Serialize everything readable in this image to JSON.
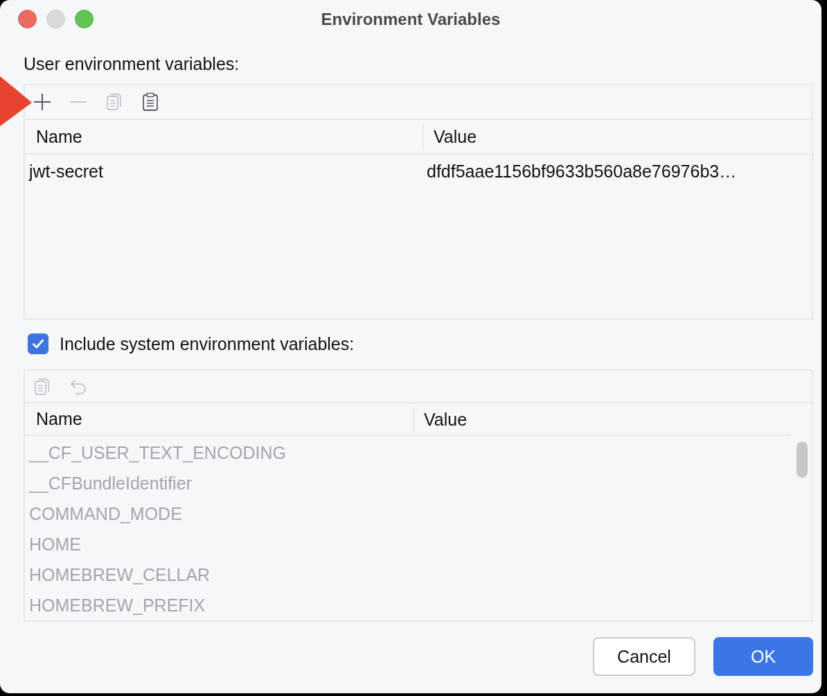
{
  "window": {
    "title": "Environment Variables"
  },
  "user_section": {
    "label": "User environment variables:",
    "read_only": false,
    "toolbar": [
      {
        "kind": "add",
        "disabled": false
      },
      {
        "kind": "remove",
        "disabled": true
      },
      {
        "kind": "copy",
        "disabled": true
      },
      {
        "kind": "paste",
        "disabled": false
      }
    ],
    "columns": [
      "Name",
      "Value"
    ],
    "rows": [
      {
        "name": "jwt-secret",
        "value": "dfdf5aae1156bf9633b560a8e76976b3…"
      }
    ]
  },
  "system_section": {
    "include_label": "Include system environment variables:",
    "checked": true,
    "read_only": true,
    "toolbar": [
      {
        "kind": "copy",
        "disabled": true
      },
      {
        "kind": "undo",
        "disabled": true
      }
    ],
    "columns": [
      "Name",
      "Value"
    ],
    "rows": [
      {
        "name": "__CF_USER_TEXT_ENCODING"
      },
      {
        "name": "__CFBundleIdentifier"
      },
      {
        "name": "COMMAND_MODE"
      },
      {
        "name": "HOME"
      },
      {
        "name": "HOMEBREW_CELLAR"
      },
      {
        "name": "HOMEBREW_PREFIX"
      }
    ]
  },
  "buttons": [
    {
      "label": "Cancel",
      "kind": "secondary"
    },
    {
      "label": "OK",
      "kind": "primary"
    }
  ]
}
